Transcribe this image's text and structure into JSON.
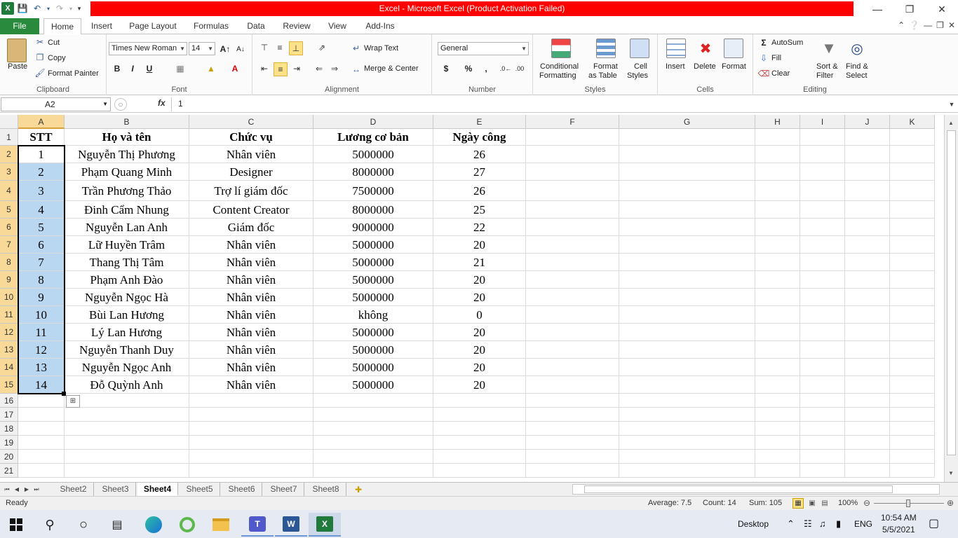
{
  "window": {
    "title": "Excel  -  Microsoft Excel (Product Activation Failed)"
  },
  "tabs": [
    {
      "label": "File"
    },
    {
      "label": "Home"
    },
    {
      "label": "Insert"
    },
    {
      "label": "Page Layout"
    },
    {
      "label": "Formulas"
    },
    {
      "label": "Data"
    },
    {
      "label": "Review"
    },
    {
      "label": "View"
    },
    {
      "label": "Add-Ins"
    }
  ],
  "ribbon": {
    "clipboard": {
      "paste": "Paste",
      "cut": "Cut",
      "copy": "Copy",
      "format_painter": "Format Painter",
      "label": "Clipboard"
    },
    "font": {
      "name": "Times New Roman",
      "size": "14",
      "bold": "B",
      "italic": "I",
      "underline": "U",
      "label": "Font"
    },
    "alignment": {
      "wrap": "Wrap Text",
      "merge": "Merge & Center",
      "label": "Alignment"
    },
    "number": {
      "format": "General",
      "currency": "$",
      "percent": "%",
      "comma": ",",
      "label": "Number"
    },
    "styles": {
      "conditional": "Conditional",
      "conditional2": "Formatting",
      "format_table": "Format",
      "format_table2": "as Table",
      "cell_styles": "Cell",
      "cell_styles2": "Styles",
      "label": "Styles"
    },
    "cells": {
      "insert": "Insert",
      "delete": "Delete",
      "format": "Format",
      "label": "Cells"
    },
    "editing": {
      "autosum": "AutoSum",
      "fill": "Fill",
      "clear": "Clear",
      "sort": "Sort &",
      "sort2": "Filter",
      "find": "Find &",
      "find2": "Select",
      "label": "Editing"
    }
  },
  "formula_bar": {
    "name_box": "A2",
    "fx": "fx",
    "value": "1"
  },
  "columns": [
    "A",
    "B",
    "C",
    "D",
    "E",
    "F",
    "G",
    "H",
    "I",
    "J",
    "K"
  ],
  "table": {
    "headers": [
      "STT",
      "Họ và tên",
      "Chức vụ",
      "Lương cơ bản",
      "Ngày công"
    ],
    "rows": [
      [
        "1",
        "Nguyễn Thị Phương",
        "Nhân viên",
        "5000000",
        "26"
      ],
      [
        "2",
        "Phạm Quang Minh",
        "Designer",
        "8000000",
        "27"
      ],
      [
        "3",
        "Trần Phương Thảo",
        "Trợ lí giám đốc",
        "7500000",
        "26"
      ],
      [
        "4",
        "Đinh Cẩm Nhung",
        "Content Creator",
        "8000000",
        "25"
      ],
      [
        "5",
        "Nguyễn Lan Anh",
        "Giám đốc",
        "9000000",
        "22"
      ],
      [
        "6",
        "Lữ Huyền Trâm",
        "Nhân viên",
        "5000000",
        "20"
      ],
      [
        "7",
        "Thang Thị Tâm",
        "Nhân viên",
        "5000000",
        "21"
      ],
      [
        "8",
        "Phạm Anh Đào",
        "Nhân viên",
        "5000000",
        "20"
      ],
      [
        "9",
        "Nguyễn Ngọc Hà",
        "Nhân viên",
        "5000000",
        "20"
      ],
      [
        "10",
        "Bùi Lan Hương",
        "Nhân viên",
        "không",
        "0"
      ],
      [
        "11",
        "Lý Lan Hương",
        "Nhân viên",
        "5000000",
        "20"
      ],
      [
        "12",
        "Nguyễn Thanh Duy",
        "Nhân viên",
        "5000000",
        "20"
      ],
      [
        "13",
        "Nguyễn Ngọc Anh",
        "Nhân viên",
        "5000000",
        "20"
      ],
      [
        "14",
        "Đỗ Quỳnh Anh",
        "Nhân viên",
        "5000000",
        "20"
      ]
    ]
  },
  "row_numbers": [
    "1",
    "2",
    "3",
    "4",
    "5",
    "6",
    "7",
    "8",
    "9",
    "10",
    "11",
    "12",
    "13",
    "14",
    "15",
    "16",
    "17",
    "18",
    "19",
    "20",
    "21"
  ],
  "sheets": [
    {
      "label": "Sheet2"
    },
    {
      "label": "Sheet3"
    },
    {
      "label": "Sheet4"
    },
    {
      "label": "Sheet5"
    },
    {
      "label": "Sheet6"
    },
    {
      "label": "Sheet7"
    },
    {
      "label": "Sheet8"
    }
  ],
  "status": {
    "ready": "Ready",
    "average": "Average: 7.5",
    "count": "Count: 14",
    "sum": "Sum: 105",
    "zoom": "100%"
  },
  "taskbar": {
    "desktop": "Desktop",
    "lang": "ENG",
    "time": "10:54 AM",
    "date": "5/5/2021"
  },
  "colors": {
    "accent": "#2a8a3c",
    "title_bar": "#ff0000",
    "selection": "#b9d7f0",
    "header_highlight": "#f9d997"
  }
}
